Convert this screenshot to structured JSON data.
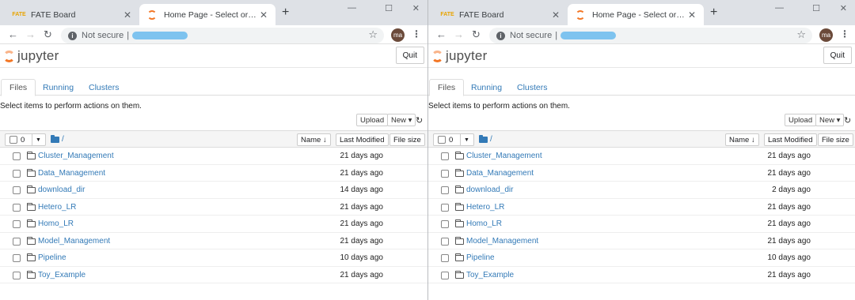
{
  "windows": [
    {
      "tabs": [
        {
          "title": "FATE Board",
          "favicon": "fate-icon",
          "active": false
        },
        {
          "title": "Home Page - Select or create a notebook",
          "favicon": "jupyter-icon",
          "active": true
        }
      ],
      "address": {
        "security_label": "Not secure",
        "separator": "|"
      },
      "profile_initials": "ma",
      "jupyter": {
        "logo_text": "jupyter",
        "quit_label": "Quit",
        "tabs": [
          "Files",
          "Running",
          "Clusters"
        ],
        "hint": "Select items to perform actions on them.",
        "upload_label": "Upload",
        "new_label": "New ▾",
        "selected_count": "0",
        "breadcrumb": "/",
        "col_name": "Name ↓",
        "col_modified": "Last Modified",
        "col_size": "File size",
        "items": [
          {
            "name": "Cluster_Management",
            "modified": "21 days ago"
          },
          {
            "name": "Data_Management",
            "modified": "21 days ago"
          },
          {
            "name": "download_dir",
            "modified": "14 days ago"
          },
          {
            "name": "Hetero_LR",
            "modified": "21 days ago"
          },
          {
            "name": "Homo_LR",
            "modified": "21 days ago"
          },
          {
            "name": "Model_Management",
            "modified": "21 days ago"
          },
          {
            "name": "Pipeline",
            "modified": "10 days ago"
          },
          {
            "name": "Toy_Example",
            "modified": "21 days ago"
          }
        ]
      }
    },
    {
      "tabs": [
        {
          "title": "FATE Board",
          "favicon": "fate-icon",
          "active": false
        },
        {
          "title": "Home Page - Select or create a notebook",
          "favicon": "jupyter-icon",
          "active": true
        }
      ],
      "address": {
        "security_label": "Not secure",
        "separator": "|"
      },
      "profile_initials": "ma",
      "jupyter": {
        "logo_text": "jupyter",
        "quit_label": "Quit",
        "tabs": [
          "Files",
          "Running",
          "Clusters"
        ],
        "hint": "Select items to perform actions on them.",
        "upload_label": "Upload",
        "new_label": "New ▾",
        "selected_count": "0",
        "breadcrumb": "/",
        "col_name": "Name ↓",
        "col_modified": "Last Modified",
        "col_size": "File size",
        "items": [
          {
            "name": "Cluster_Management",
            "modified": "21 days ago"
          },
          {
            "name": "Data_Management",
            "modified": "21 days ago"
          },
          {
            "name": "download_dir",
            "modified": "2 days ago"
          },
          {
            "name": "Hetero_LR",
            "modified": "21 days ago"
          },
          {
            "name": "Homo_LR",
            "modified": "21 days ago"
          },
          {
            "name": "Model_Management",
            "modified": "21 days ago"
          },
          {
            "name": "Pipeline",
            "modified": "10 days ago"
          },
          {
            "name": "Toy_Example",
            "modified": "21 days ago"
          }
        ]
      }
    }
  ],
  "colors": {
    "link": "#337ab7",
    "tabstrip": "#dee1e6",
    "jupyter_orange": "#f37726"
  }
}
